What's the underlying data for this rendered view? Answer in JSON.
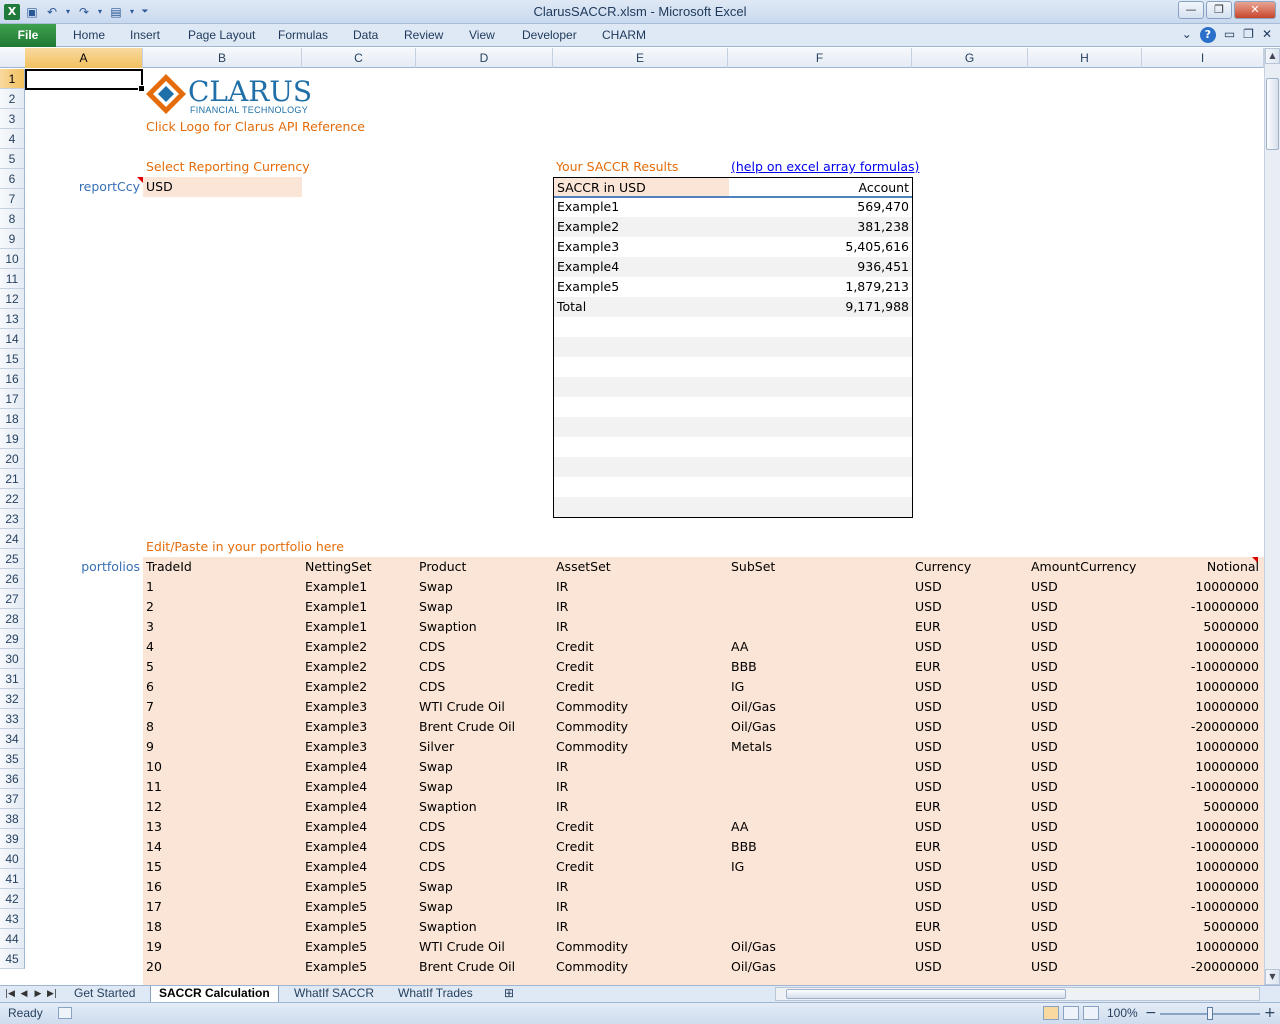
{
  "window": {
    "title": "ClarusSACCR.xlsm  -  Microsoft Excel",
    "minimize": "—",
    "restore": "❐",
    "close": "✕"
  },
  "ribbon": {
    "file": "File",
    "tabs": [
      "Home",
      "Insert",
      "Page Layout",
      "Formulas",
      "Data",
      "Review",
      "View",
      "Developer",
      "CHARM"
    ]
  },
  "columns": [
    "A",
    "B",
    "C",
    "D",
    "E",
    "F",
    "G",
    "H",
    "I"
  ],
  "rows": [
    "1",
    "2",
    "3",
    "4",
    "5",
    "6",
    "7",
    "8",
    "9",
    "10",
    "11",
    "12",
    "13",
    "14",
    "15",
    "16",
    "17",
    "18",
    "19",
    "20",
    "21",
    "22",
    "23",
    "24",
    "25",
    "26",
    "27",
    "28",
    "29",
    "30",
    "31",
    "32",
    "33",
    "34",
    "35",
    "36",
    "37",
    "38",
    "39",
    "40",
    "41",
    "42",
    "43",
    "44",
    "45"
  ],
  "sheet": {
    "logo_text": "CLARUS",
    "logo_subtext": "FINANCIAL TECHNOLOGY",
    "logo_hint": "Click Logo for Clarus API Reference",
    "select_currency_label": "Select Reporting Currency",
    "report_ccy_name": "reportCcy",
    "report_ccy_value": "USD",
    "results_label": "Your SACCR Results",
    "help_link": "(help on excel array formulas)",
    "results_header_left": "SACCR in USD",
    "results_header_right": "Account",
    "results": [
      {
        "name": "Example1",
        "value": "569,470"
      },
      {
        "name": "Example2",
        "value": "381,238"
      },
      {
        "name": "Example3",
        "value": "5,405,616"
      },
      {
        "name": "Example4",
        "value": "936,451"
      },
      {
        "name": "Example5",
        "value": "1,879,213"
      },
      {
        "name": "Total",
        "value": "9,171,988"
      }
    ],
    "portfolio_label": "Edit/Paste in your portfolio here",
    "portfolios_name": "portfolios",
    "portfolio_headers": [
      "TradeId",
      "NettingSet",
      "Product",
      "AssetSet",
      "SubSet",
      "Currency",
      "AmountCurrency",
      "Notional"
    ],
    "trades": [
      [
        "1",
        "Example1",
        "Swap",
        "IR",
        "",
        "USD",
        "USD",
        "10000000"
      ],
      [
        "2",
        "Example1",
        "Swap",
        "IR",
        "",
        "USD",
        "USD",
        "-10000000"
      ],
      [
        "3",
        "Example1",
        "Swaption",
        "IR",
        "",
        "EUR",
        "USD",
        "5000000"
      ],
      [
        "4",
        "Example2",
        "CDS",
        "Credit",
        "AA",
        "USD",
        "USD",
        "10000000"
      ],
      [
        "5",
        "Example2",
        "CDS",
        "Credit",
        "BBB",
        "EUR",
        "USD",
        "-10000000"
      ],
      [
        "6",
        "Example2",
        "CDS",
        "Credit",
        "IG",
        "USD",
        "USD",
        "10000000"
      ],
      [
        "7",
        "Example3",
        "WTI Crude Oil",
        "Commodity",
        "Oil/Gas",
        "USD",
        "USD",
        "10000000"
      ],
      [
        "8",
        "Example3",
        "Brent Crude Oil",
        "Commodity",
        "Oil/Gas",
        "USD",
        "USD",
        "-20000000"
      ],
      [
        "9",
        "Example3",
        "Silver",
        "Commodity",
        "Metals",
        "USD",
        "USD",
        "10000000"
      ],
      [
        "10",
        "Example4",
        "Swap",
        "IR",
        "",
        "USD",
        "USD",
        "10000000"
      ],
      [
        "11",
        "Example4",
        "Swap",
        "IR",
        "",
        "USD",
        "USD",
        "-10000000"
      ],
      [
        "12",
        "Example4",
        "Swaption",
        "IR",
        "",
        "EUR",
        "USD",
        "5000000"
      ],
      [
        "13",
        "Example4",
        "CDS",
        "Credit",
        "AA",
        "USD",
        "USD",
        "10000000"
      ],
      [
        "14",
        "Example4",
        "CDS",
        "Credit",
        "BBB",
        "EUR",
        "USD",
        "-10000000"
      ],
      [
        "15",
        "Example4",
        "CDS",
        "Credit",
        "IG",
        "USD",
        "USD",
        "10000000"
      ],
      [
        "16",
        "Example5",
        "Swap",
        "IR",
        "",
        "USD",
        "USD",
        "10000000"
      ],
      [
        "17",
        "Example5",
        "Swap",
        "IR",
        "",
        "USD",
        "USD",
        "-10000000"
      ],
      [
        "18",
        "Example5",
        "Swaption",
        "IR",
        "",
        "EUR",
        "USD",
        "5000000"
      ],
      [
        "19",
        "Example5",
        "WTI Crude Oil",
        "Commodity",
        "Oil/Gas",
        "USD",
        "USD",
        "10000000"
      ],
      [
        "20",
        "Example5",
        "Brent Crude Oil",
        "Commodity",
        "Oil/Gas",
        "USD",
        "USD",
        "-20000000"
      ]
    ]
  },
  "sheet_tabs": [
    "Get Started",
    "SACCR Calculation",
    "WhatIf SACCR",
    "WhatIf Trades"
  ],
  "active_sheet_tab": "SACCR Calculation",
  "status": {
    "ready": "Ready",
    "zoom": "100%",
    "zoom_minus": "−",
    "zoom_plus": "+"
  },
  "colors": {
    "accent_orange": "#e46c0a",
    "name_blue": "#376fb5",
    "input_peach": "#fbe5d6",
    "file_tab_green": "#1e7a32"
  }
}
